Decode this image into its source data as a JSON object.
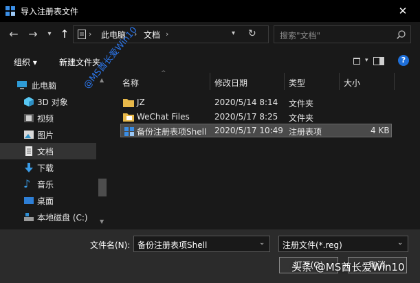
{
  "window": {
    "title": "导入注册表文件",
    "close_glyph": "✕"
  },
  "address": {
    "crumbs": [
      "此电脑",
      "文档"
    ],
    "search_placeholder": "搜索\"文档\""
  },
  "toolbar": {
    "organize_label": "组织 ▾",
    "new_folder_label": "新建文件夹"
  },
  "nav_pane": {
    "items": [
      {
        "label": "此电脑",
        "icon": "pc-icon"
      },
      {
        "label": "3D 对象",
        "icon": "cube-icon"
      },
      {
        "label": "视频",
        "icon": "video-icon"
      },
      {
        "label": "图片",
        "icon": "picture-icon"
      },
      {
        "label": "文档",
        "icon": "document-icon",
        "selected": true
      },
      {
        "label": "下载",
        "icon": "download-icon"
      },
      {
        "label": "音乐",
        "icon": "music-icon"
      },
      {
        "label": "桌面",
        "icon": "desktop-icon"
      },
      {
        "label": "本地磁盘 (C:)",
        "icon": "drive-icon"
      }
    ]
  },
  "columns": {
    "name": "名称",
    "date": "修改日期",
    "type": "类型",
    "size": "大小"
  },
  "files": [
    {
      "name": "JZ",
      "date": "2020/5/14 8:14",
      "type": "文件夹",
      "size": "",
      "icon": "folder-icon"
    },
    {
      "name": "WeChat Files",
      "date": "2020/5/17 8:25",
      "type": "文件夹",
      "size": "",
      "icon": "folder-icon"
    },
    {
      "name": "备份注册表项Shell",
      "date": "2020/5/17 10:49",
      "type": "注册表项",
      "size": "4 KB",
      "icon": "registry-file-icon",
      "selected": true
    }
  ],
  "bottom": {
    "filename_label": "文件名(N):",
    "filename_value": "备份注册表项Shell",
    "filetype_value": "注册文件(*.reg)",
    "open_label": "打开(O)",
    "cancel_label": "取消"
  },
  "watermarks": {
    "diagonal": "@MS酋长爱Win10",
    "footer": "头条 @MS酋长爱Win10"
  },
  "colors": {
    "accent": "#2e7fff",
    "background": "#191919",
    "titlebar": "#000000",
    "selection": "#4a4a4a"
  }
}
